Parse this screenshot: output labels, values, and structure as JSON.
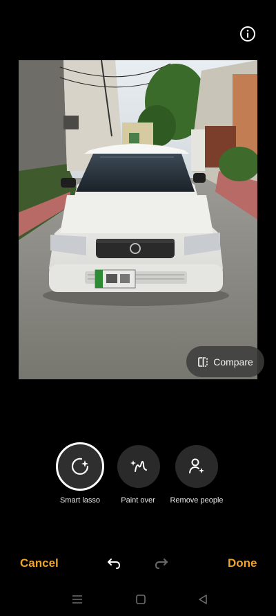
{
  "header": {
    "info_icon": "info-icon"
  },
  "photo": {
    "subject": "white car parked in a street"
  },
  "compare": {
    "label": "Compare",
    "icon": "compare-icon"
  },
  "tools": [
    {
      "label": "Smart lasso",
      "icon": "smart-lasso-icon",
      "selected": true
    },
    {
      "label": "Paint over",
      "icon": "paint-over-icon",
      "selected": false
    },
    {
      "label": "Remove people",
      "icon": "remove-people-icon",
      "selected": false
    }
  ],
  "actions": {
    "cancel_label": "Cancel",
    "done_label": "Done",
    "accent_color": "#f0a329"
  },
  "nav": {
    "icons": [
      "recents-icon",
      "home-icon",
      "back-icon"
    ]
  }
}
